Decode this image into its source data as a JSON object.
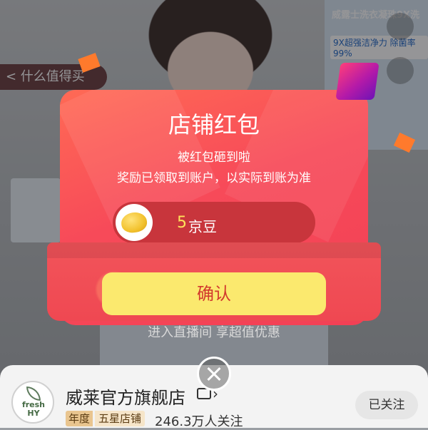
{
  "background": {
    "back_label": "< 什么值得买",
    "poster_title": "威露士洗衣凝珠9X洗",
    "poster_sub": "9X超强洁净力 除菌率99%",
    "live_hint": "进入直播间 享超值优惠"
  },
  "modal": {
    "title": "店铺红包",
    "subtitle_line1": "被红包砸到啦",
    "subtitle_line2": "奖励已领取到账户，以实际到账为准",
    "reward_amount": "5",
    "reward_unit": "京豆",
    "confirm_label": "确认"
  },
  "shop": {
    "logo_text": "fresh HY",
    "name": "威莱官方旗舰店",
    "badge_year": "年度",
    "badge_level": "五星店铺",
    "followers": "246.3万人关注",
    "follow_button": "已关注"
  },
  "colors": {
    "packet_red": "#f74a59",
    "confirm_yellow": "#fbe96e",
    "reward_gold": "#ffe25a"
  }
}
